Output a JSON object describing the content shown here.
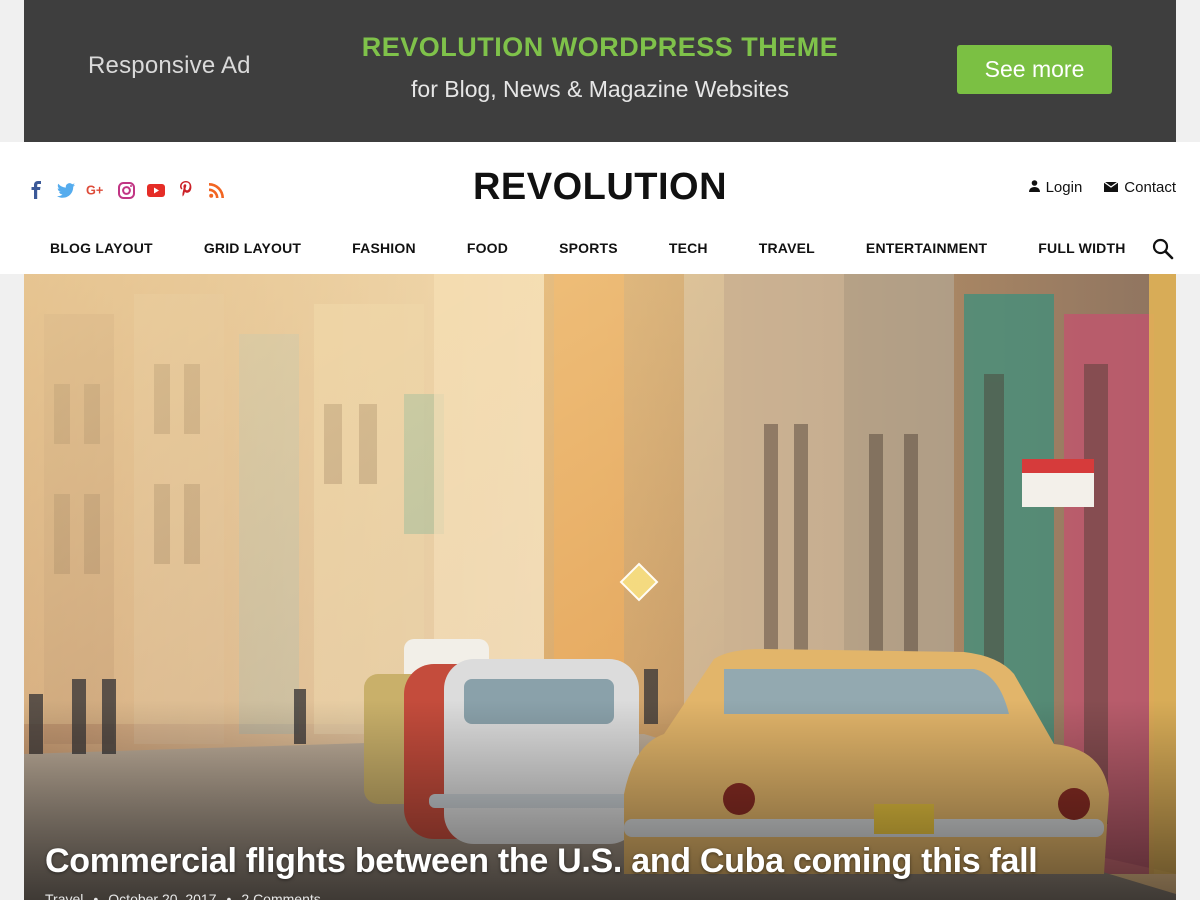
{
  "ad": {
    "label": "Responsive Ad",
    "headline": "REVOLUTION WORDPRESS THEME",
    "subline": "for Blog, News & Magazine Websites",
    "button": "See more",
    "colors": {
      "background": "#3e3e3e",
      "accent": "#7bc043"
    }
  },
  "header": {
    "logo": "REVOLUTION",
    "socials": [
      "facebook-icon",
      "twitter-icon",
      "google-plus-icon",
      "instagram-icon",
      "youtube-icon",
      "pinterest-icon",
      "rss-icon"
    ],
    "login": "Login",
    "contact": "Contact"
  },
  "nav": {
    "items": [
      "BLOG LAYOUT",
      "GRID LAYOUT",
      "FASHION",
      "FOOD",
      "SPORTS",
      "TECH",
      "TRAVEL",
      "ENTERTAINMENT",
      "FULL WIDTH"
    ]
  },
  "hero": {
    "title": "Commercial flights between the U.S. and Cuba coming this fall",
    "category": "Travel",
    "date": "October 20, 2017",
    "comments": "2 Comments",
    "separator": "•"
  }
}
